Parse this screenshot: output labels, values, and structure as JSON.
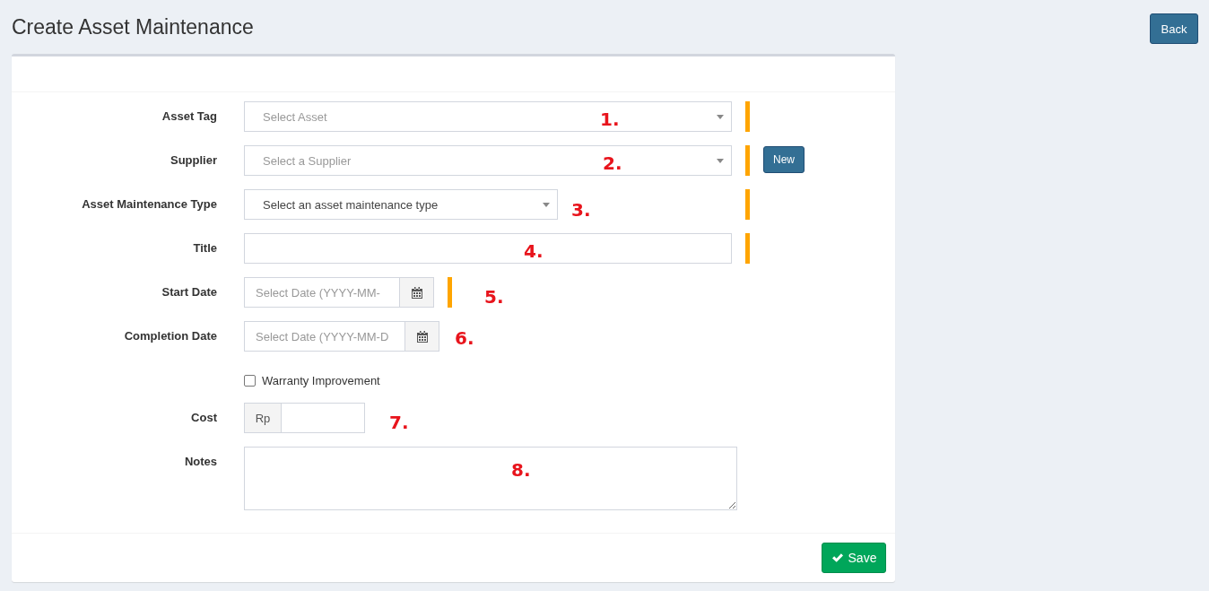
{
  "page": {
    "title": "Create Asset Maintenance",
    "back_button": "Back"
  },
  "fields": [
    {
      "kind": "select",
      "label": "Asset Tag",
      "placeholder": "Select Asset",
      "required": true,
      "annotation": "1."
    },
    {
      "kind": "select",
      "label": "Supplier",
      "placeholder": "Select a Supplier",
      "required": true,
      "new_button": "New",
      "annotation": "2."
    },
    {
      "kind": "select",
      "label": "Asset Maintenance Type",
      "value": "Select an asset maintenance type",
      "required": true,
      "annotation": "3."
    },
    {
      "kind": "text",
      "label": "Title",
      "required": true,
      "annotation": "4."
    },
    {
      "kind": "date",
      "label": "Start Date",
      "placeholder": "Select Date (YYYY-MM-",
      "required": true,
      "annotation": "5."
    },
    {
      "kind": "date",
      "label": "Completion Date",
      "placeholder": "Select Date (YYYY-MM-D",
      "required": false,
      "annotation": "6."
    },
    {
      "kind": "checkbox",
      "label": "Warranty Improvement",
      "checked": false
    },
    {
      "kind": "currency",
      "label": "Cost",
      "prefix": "Rp",
      "required": false,
      "annotation": "7."
    },
    {
      "kind": "textarea",
      "label": "Notes",
      "required": false,
      "annotation": "8."
    }
  ],
  "footer": {
    "save_button": "Save"
  }
}
